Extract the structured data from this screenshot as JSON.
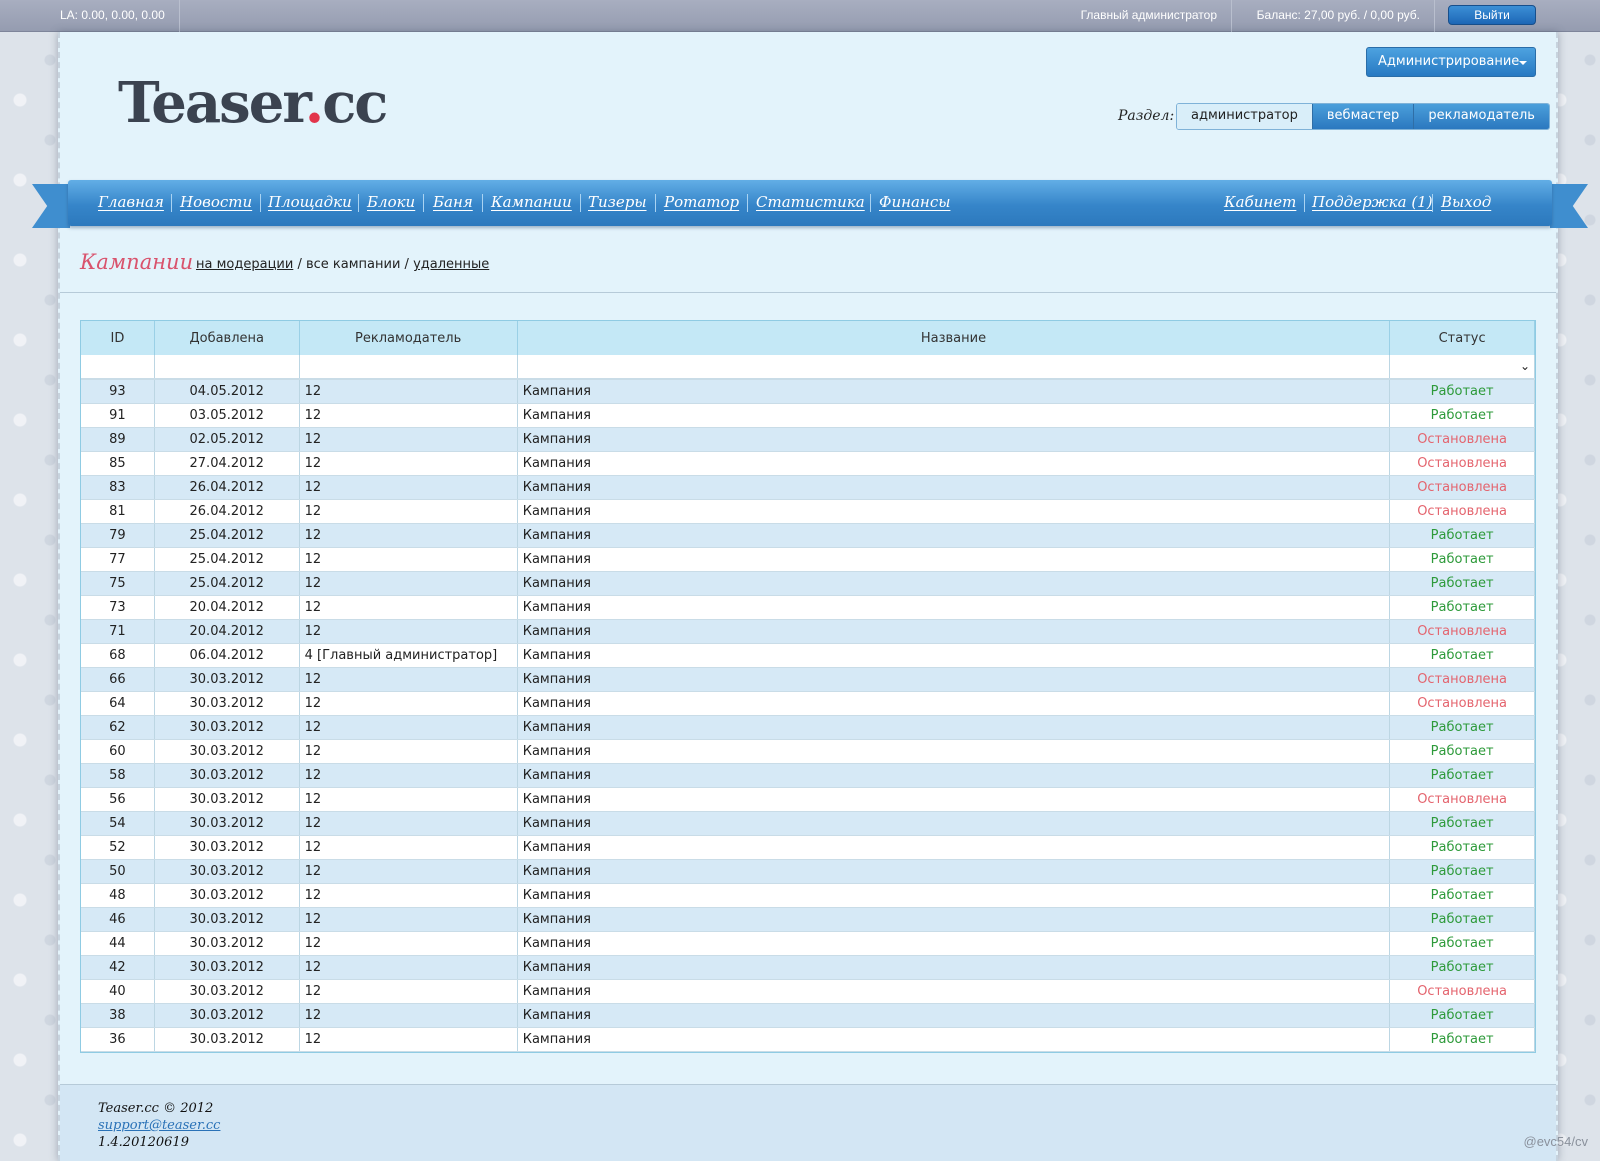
{
  "topbar": {
    "la": "LA: 0.00, 0.00, 0.00",
    "user": "Главный администратор",
    "balance": "Баланс: 27,00 руб. / 0,00 руб.",
    "logout": "Выйти"
  },
  "header": {
    "logo_main": "Teaser",
    "logo_dot": ".",
    "logo_tail": "cc",
    "admin_menu": "Администрирование",
    "section_label": "Раздел:",
    "sections": [
      "администратор",
      "вебмастер",
      "рекламодатель"
    ]
  },
  "nav": {
    "left": [
      "Главная",
      "Новости",
      "Площадки",
      "Блоки",
      "Баня",
      "Кампании",
      "Тизеры",
      "Ротатор",
      "Статистика",
      "Финансы"
    ],
    "right": [
      "Кабинет",
      "Поддержка (1)",
      "Выход"
    ]
  },
  "page": {
    "title": "Кампании",
    "filter_moderation": "на модерации",
    "sep1": " / ",
    "filter_all": "все кампании",
    "sep2": " / ",
    "filter_deleted": "удаленные"
  },
  "table": {
    "columns": [
      "ID",
      "Добавлена",
      "Рекламодатель",
      "Название",
      "Статус"
    ],
    "rows": [
      {
        "id": "93",
        "date": "04.05.2012",
        "adv": "12",
        "name": "Кампания",
        "status": "Работает"
      },
      {
        "id": "91",
        "date": "03.05.2012",
        "adv": "12",
        "name": "Кампания",
        "status": "Работает"
      },
      {
        "id": "89",
        "date": "02.05.2012",
        "adv": "12",
        "name": "Кампания",
        "status": "Остановлена"
      },
      {
        "id": "85",
        "date": "27.04.2012",
        "adv": "12",
        "name": "Кампания",
        "status": "Остановлена"
      },
      {
        "id": "83",
        "date": "26.04.2012",
        "adv": "12",
        "name": "Кампания",
        "status": "Остановлена"
      },
      {
        "id": "81",
        "date": "26.04.2012",
        "adv": "12",
        "name": "Кампания",
        "status": "Остановлена"
      },
      {
        "id": "79",
        "date": "25.04.2012",
        "adv": "12",
        "name": "Кампания",
        "status": "Работает"
      },
      {
        "id": "77",
        "date": "25.04.2012",
        "adv": "12",
        "name": "Кампания",
        "status": "Работает"
      },
      {
        "id": "75",
        "date": "25.04.2012",
        "adv": "12",
        "name": "Кампания",
        "status": "Работает"
      },
      {
        "id": "73",
        "date": "20.04.2012",
        "adv": "12",
        "name": "Кампания",
        "status": "Работает"
      },
      {
        "id": "71",
        "date": "20.04.2012",
        "adv": "12",
        "name": "Кампания",
        "status": "Остановлена"
      },
      {
        "id": "68",
        "date": "06.04.2012",
        "adv": "4 [Главный администратор]",
        "name": "Кампания",
        "status": "Работает"
      },
      {
        "id": "66",
        "date": "30.03.2012",
        "adv": "12",
        "name": "Кампания",
        "status": "Остановлена"
      },
      {
        "id": "64",
        "date": "30.03.2012",
        "adv": "12",
        "name": "Кампания",
        "status": "Остановлена"
      },
      {
        "id": "62",
        "date": "30.03.2012",
        "adv": "12",
        "name": "Кампания",
        "status": "Работает"
      },
      {
        "id": "60",
        "date": "30.03.2012",
        "adv": "12",
        "name": "Кампания",
        "status": "Работает"
      },
      {
        "id": "58",
        "date": "30.03.2012",
        "adv": "12",
        "name": "Кампания",
        "status": "Работает"
      },
      {
        "id": "56",
        "date": "30.03.2012",
        "adv": "12",
        "name": "Кампания",
        "status": "Остановлена"
      },
      {
        "id": "54",
        "date": "30.03.2012",
        "adv": "12",
        "name": "Кампания",
        "status": "Работает"
      },
      {
        "id": "52",
        "date": "30.03.2012",
        "adv": "12",
        "name": "Кампания",
        "status": "Работает"
      },
      {
        "id": "50",
        "date": "30.03.2012",
        "adv": "12",
        "name": "Кампания",
        "status": "Работает"
      },
      {
        "id": "48",
        "date": "30.03.2012",
        "adv": "12",
        "name": "Кампания",
        "status": "Работает"
      },
      {
        "id": "46",
        "date": "30.03.2012",
        "adv": "12",
        "name": "Кампания",
        "status": "Работает"
      },
      {
        "id": "44",
        "date": "30.03.2012",
        "adv": "12",
        "name": "Кампания",
        "status": "Работает"
      },
      {
        "id": "42",
        "date": "30.03.2012",
        "adv": "12",
        "name": "Кампания",
        "status": "Работает"
      },
      {
        "id": "40",
        "date": "30.03.2012",
        "adv": "12",
        "name": "Кампания",
        "status": "Остановлена"
      },
      {
        "id": "38",
        "date": "30.03.2012",
        "adv": "12",
        "name": "Кампания",
        "status": "Работает"
      },
      {
        "id": "36",
        "date": "30.03.2012",
        "adv": "12",
        "name": "Кампания",
        "status": "Работает"
      }
    ]
  },
  "status_colors": {
    "Работает": "#2d9a3a",
    "Остановлена": "#e4646e"
  },
  "footer": {
    "copyright": "Teaser.cc © 2012",
    "email": "support@teaser.cc",
    "version": "1.4.20120619"
  },
  "watermark": "@evc54/cv"
}
